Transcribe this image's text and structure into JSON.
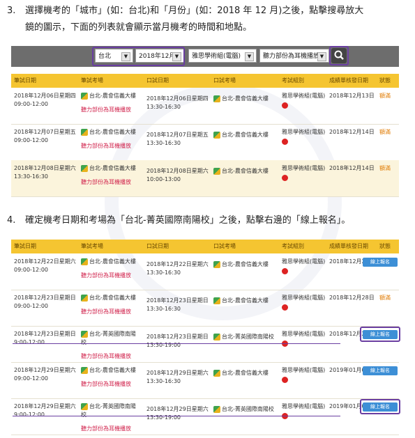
{
  "step3": {
    "num": "3.",
    "line1": "選擇機考的「城市」(如：台北)和「月份」(如：2018 年 12 月)之後，點擊搜尋放大",
    "line2": "鏡的圖示，下面的列表就會顯示當月機考的時間和地點。"
  },
  "search": {
    "city": "台北",
    "month": "2018年12月",
    "module": "雅思學術組(電腦)",
    "listening": "聽力部份為耳機播放"
  },
  "step4": {
    "num": "4.",
    "text": "確定機考日期和考場為「台北-菁英國際南陽校」之後，點擊右邊的「線上報名」。"
  },
  "table_headers": [
    "筆試日期",
    "筆試考場",
    "口試日期",
    "口試考場",
    "考試組別",
    "成績單核發日期",
    "狀態"
  ],
  "table1": [
    {
      "written_date": "2018年12月06日星期四",
      "written_time": "09:00-12:00",
      "venue": "台北-農會信義大樓",
      "sub": "聽力部份為耳機播放",
      "oral_date": "2018年12月06日星期四",
      "oral_time": "13:30-16:30",
      "oral_venue": "台北-農會信義大樓",
      "module": "雅思學術組(電腦)",
      "result_date": "2018年12月13日",
      "status": "額滿"
    },
    {
      "written_date": "2018年12月07日星期五",
      "written_time": "09:00-12:00",
      "venue": "台北-農會信義大樓",
      "sub": "聽力部份為耳機播放",
      "oral_date": "2018年12月07日星期五",
      "oral_time": "13:30-16:30",
      "oral_venue": "台北-農會信義大樓",
      "module": "雅思學術組(電腦)",
      "result_date": "2018年12月14日",
      "status": "額滿"
    },
    {
      "written_date": "2018年12月08日星期六",
      "written_time": "13:30-16:30",
      "venue": "台北-農會信義大樓",
      "sub": "聽力部份為耳機播放",
      "oral_date": "2018年12月08日星期六",
      "oral_time": "10:00-13:00",
      "oral_venue": "台北-農會信義大樓",
      "module": "雅思學術組(電腦)",
      "result_date": "2018年12月14日",
      "status": "額滿"
    }
  ],
  "table2": [
    {
      "written_date": "2018年12月22日星期六",
      "written_time": "09:00-12:00",
      "venue": "台北-農會信義大樓",
      "sub": "聽力部份為耳機播放",
      "oral_date": "2018年12月22日星期六",
      "oral_time": "13:30-16:30",
      "oral_venue": "台北-農會信義大樓",
      "module": "雅思學術組(電腦)",
      "result_date": "2018年12月28日",
      "status": "線上報名"
    },
    {
      "written_date": "2018年12月23日星期日",
      "written_time": "09:00-12:00",
      "venue": "台北-農會信義大樓",
      "sub": "聽力部份為耳機播放",
      "oral_date": "2018年12月23日星期日",
      "oral_time": "13:30-16:30",
      "oral_venue": "台北-農會信義大樓",
      "module": "雅思學術組(電腦)",
      "result_date": "2018年12月28日",
      "status": "額滿"
    },
    {
      "written_date": "2018年12月23日星期日",
      "written_time": "9:00-12:00",
      "venue": "台北-菁英國際南陽校",
      "sub": "聽力部份為耳機播放",
      "oral_date": "2018年12月23日星期日",
      "oral_time": "13:30-19:00",
      "oral_venue": "台北-菁英國際南陽校",
      "module": "雅思學術組(電腦)",
      "result_date": "2018年12月28日",
      "status": "線上報名"
    },
    {
      "written_date": "2018年12月29日星期六",
      "written_time": "09:00-12:00",
      "venue": "台北-農會信義大樓",
      "sub": "聽力部份為耳機播放",
      "oral_date": "2018年12月29日星期六",
      "oral_time": "13:30-16:30",
      "oral_venue": "台北-農會信義大樓",
      "module": "雅思學術組(電腦)",
      "result_date": "2019年01月04日",
      "status": "線上報名"
    },
    {
      "written_date": "2018年12月29日星期六",
      "written_time": "9:00-12:00",
      "venue": "台北-菁英國際南陽校",
      "sub": "聽力部份為耳機播放",
      "oral_date": "2018年12月29日星期六",
      "oral_time": "13:30-19:00",
      "oral_venue": "台北-菁英國際南陽校",
      "module": "雅思學術組(電腦)",
      "result_date": "2019年01月04日",
      "status": "線上報名"
    }
  ],
  "colors": {
    "header_bg": "#f5c531",
    "highlight": "#6a3ea1",
    "full": "#e07a00",
    "button": "#3d8fd6",
    "sub_text": "#d0204a"
  }
}
